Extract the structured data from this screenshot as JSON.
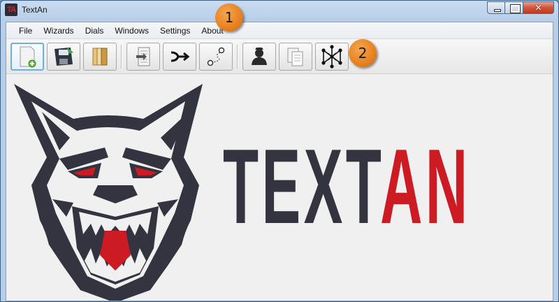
{
  "window": {
    "title": "TextAn",
    "icon_letters": "TA"
  },
  "menu": {
    "items": [
      {
        "label": "File"
      },
      {
        "label": "Wizards"
      },
      {
        "label": "Dials"
      },
      {
        "label": "Windows"
      },
      {
        "label": "Settings"
      },
      {
        "label": "About"
      }
    ]
  },
  "toolbar": {
    "buttons": [
      {
        "icon": "new-document-icon"
      },
      {
        "icon": "save-floppy-icon"
      },
      {
        "icon": "open-folder-icon"
      },
      {
        "icon": "import-document-icon"
      },
      {
        "icon": "merge-arrow-icon"
      },
      {
        "icon": "path-trace-icon"
      },
      {
        "icon": "person-icon"
      },
      {
        "icon": "copy-documents-icon"
      },
      {
        "icon": "network-graph-icon"
      }
    ]
  },
  "annotations": [
    {
      "label": "1"
    },
    {
      "label": "2"
    }
  ],
  "logo": {
    "text_dark": "TEXT",
    "text_red": "AN"
  },
  "colors": {
    "brand_dark": "#33343f",
    "brand_red": "#cc1b22",
    "badge_orange": "#e8811f",
    "active_border": "#6eb0e6"
  }
}
